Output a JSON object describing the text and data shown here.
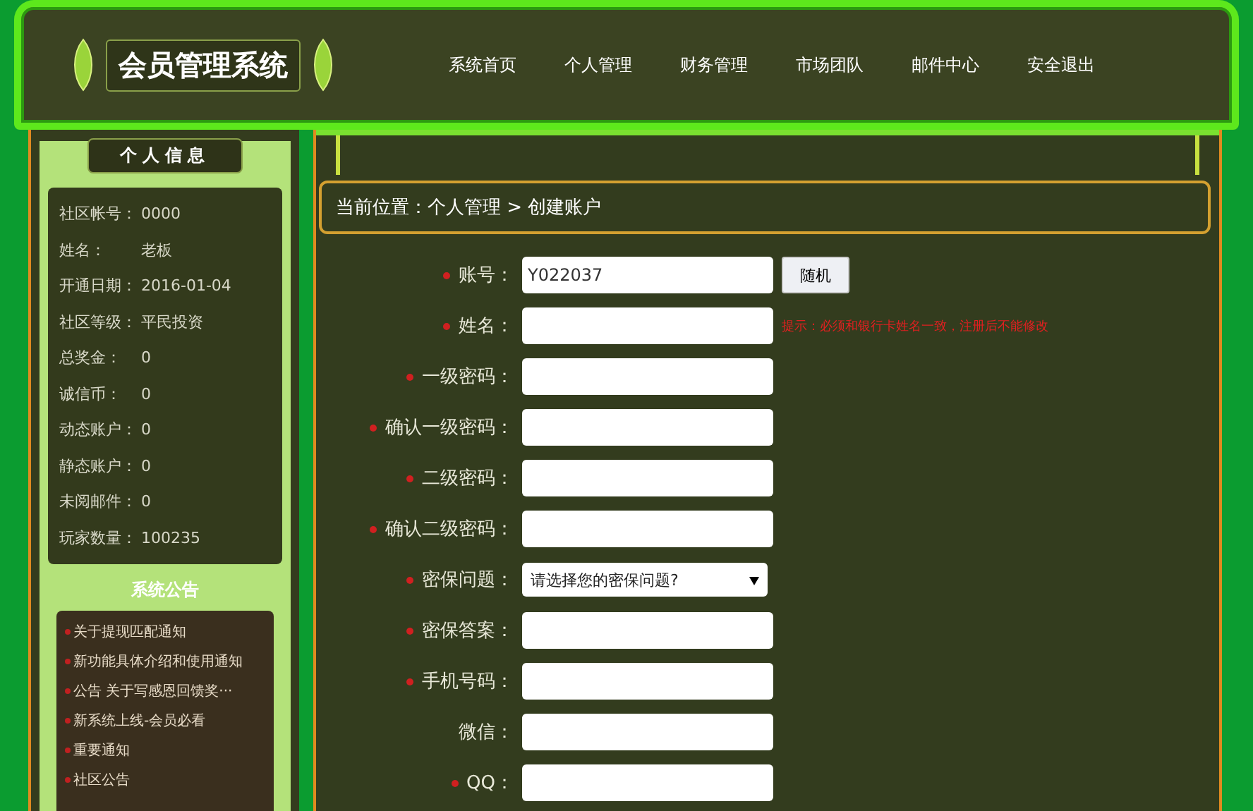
{
  "header": {
    "title": "会员管理系统",
    "nav": [
      {
        "label": "系统首页",
        "selected": false
      },
      {
        "label": "个人管理",
        "selected": false
      },
      {
        "label": "财务管理",
        "selected": false
      },
      {
        "label": "市场团队",
        "selected": false
      },
      {
        "label": "邮件中心",
        "selected": false
      },
      {
        "label": "安全退出",
        "selected": false
      }
    ]
  },
  "sidebar": {
    "info_title": "个人信息",
    "info": [
      {
        "label": "社区帐号：",
        "value": "0000"
      },
      {
        "label": "姓名：",
        "value": "老板"
      },
      {
        "label": "开通日期：",
        "value": "2016-01-04"
      },
      {
        "label": "社区等级：",
        "value": "平民投资"
      },
      {
        "label": "总奖金：",
        "value": "0"
      },
      {
        "label": "诚信币：",
        "value": "0"
      },
      {
        "label": "动态账户：",
        "value": "0"
      },
      {
        "label": "静态账户：",
        "value": "0"
      },
      {
        "label": "未阅邮件：",
        "value": "0"
      },
      {
        "label": "玩家数量：",
        "value": "100235"
      }
    ],
    "notice_title": "系统公告",
    "notices": [
      "关于提现匹配通知",
      "新功能具体介绍和使用通知",
      "公告 关于写感恩回馈奖···",
      "新系统上线-会员必看",
      "重要通知",
      "社区公告"
    ]
  },
  "breadcrumb": "当前位置：个人管理 > 创建账户",
  "form": [
    {
      "kind": "text",
      "label": "账号：",
      "required": true,
      "value": "Y022037",
      "button": "随机"
    },
    {
      "kind": "text",
      "label": "姓名：",
      "required": true,
      "hint": "提示：必须和银行卡姓名一致，注册后不能修改"
    },
    {
      "kind": "text",
      "label": "一级密码：",
      "required": true
    },
    {
      "kind": "text",
      "label": "确认一级密码：",
      "required": true
    },
    {
      "kind": "text",
      "label": "二级密码：",
      "required": true
    },
    {
      "kind": "text",
      "label": "确认二级密码：",
      "required": true
    },
    {
      "kind": "select",
      "label": "密保问题：",
      "required": true,
      "value": "请选择您的密保问题?"
    },
    {
      "kind": "text",
      "label": "密保答案：",
      "required": true
    },
    {
      "kind": "text",
      "label": "手机号码：",
      "required": true
    },
    {
      "kind": "text",
      "label": "微信：",
      "required": false
    },
    {
      "kind": "text",
      "label": "QQ：",
      "required": true
    }
  ]
}
